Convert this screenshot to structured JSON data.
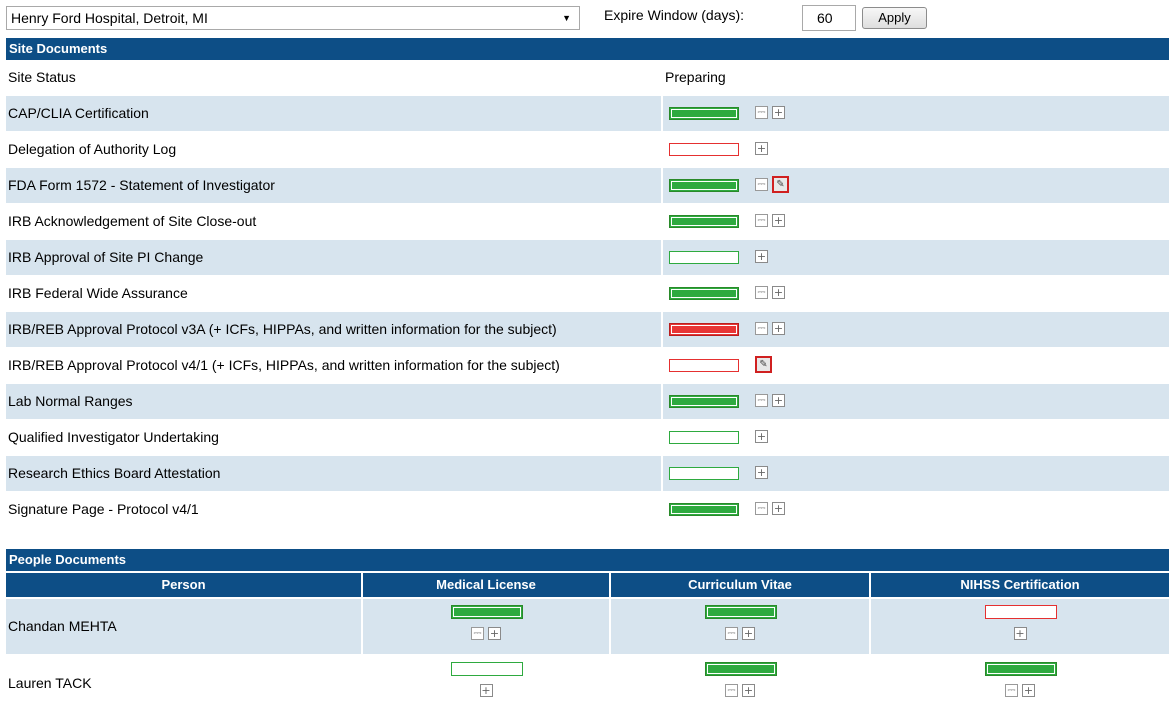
{
  "toolbar": {
    "site_value": "Henry Ford Hospital, Detroit, MI",
    "expire_label": "Expire Window (days):",
    "expire_value": "60",
    "apply_label": "Apply"
  },
  "site_docs": {
    "title": "Site Documents",
    "col_status": "Site Status",
    "col_preparing": "Preparing",
    "rows": [
      {
        "label": "CAP/CLIA Certification",
        "status": "complete",
        "icons": [
          "pdf",
          "add"
        ]
      },
      {
        "label": "Delegation of Authority Log",
        "status": "missing-required",
        "icons": [
          "add"
        ]
      },
      {
        "label": "FDA Form 1572 - Statement of Investigator",
        "status": "complete",
        "icons": [
          "pdf",
          "edit"
        ]
      },
      {
        "label": "IRB Acknowledgement of Site Close-out",
        "status": "complete",
        "icons": [
          "pdf",
          "add"
        ]
      },
      {
        "label": "IRB Approval of Site PI Change",
        "status": "missing-optional",
        "icons": [
          "add"
        ]
      },
      {
        "label": "IRB Federal Wide Assurance",
        "status": "complete",
        "icons": [
          "pdf",
          "add"
        ]
      },
      {
        "label": "IRB/REB Approval Protocol v3A (+ ICFs, HIPPAs, and written information for the subject)",
        "status": "expired",
        "icons": [
          "pdf",
          "add"
        ]
      },
      {
        "label": "IRB/REB Approval Protocol v4/1 (+ ICFs, HIPPAs, and written information for the subject)",
        "status": "missing-required",
        "icons": [
          "edit"
        ]
      },
      {
        "label": "Lab Normal Ranges",
        "status": "complete",
        "icons": [
          "pdf",
          "add"
        ]
      },
      {
        "label": "Qualified Investigator Undertaking",
        "status": "missing-optional",
        "icons": [
          "add"
        ]
      },
      {
        "label": "Research Ethics Board Attestation",
        "status": "missing-optional",
        "icons": [
          "add"
        ]
      },
      {
        "label": "Signature Page - Protocol v4/1",
        "status": "complete",
        "icons": [
          "pdf",
          "add"
        ]
      }
    ]
  },
  "people_docs": {
    "title": "People Documents",
    "columns": [
      "Person",
      "Medical License",
      "Curriculum Vitae",
      "NIHSS Certification"
    ],
    "rows": [
      {
        "name": "Chandan MEHTA",
        "cells": [
          {
            "status": "complete",
            "icons": [
              "pdf",
              "add"
            ]
          },
          {
            "status": "complete",
            "icons": [
              "pdf",
              "add"
            ]
          },
          {
            "status": "missing-required",
            "icons": [
              "add"
            ]
          }
        ]
      },
      {
        "name": "Lauren TACK",
        "cells": [
          {
            "status": "missing-optional",
            "icons": [
              "add"
            ]
          },
          {
            "status": "complete",
            "icons": [
              "pdf",
              "add"
            ]
          },
          {
            "status": "complete",
            "icons": [
              "pdf",
              "add"
            ]
          }
        ]
      }
    ]
  },
  "status_colors": {
    "complete": "#2eaa3f",
    "missing-required": "#e53030",
    "missing-optional": "#2eaa3f",
    "expired": "#e83535",
    "header": "#0d4e86",
    "row_shade": "#d7e4ee"
  },
  "icon_names": {
    "pdf": "pdf-icon",
    "add": "add-icon",
    "edit": "edit-icon"
  }
}
